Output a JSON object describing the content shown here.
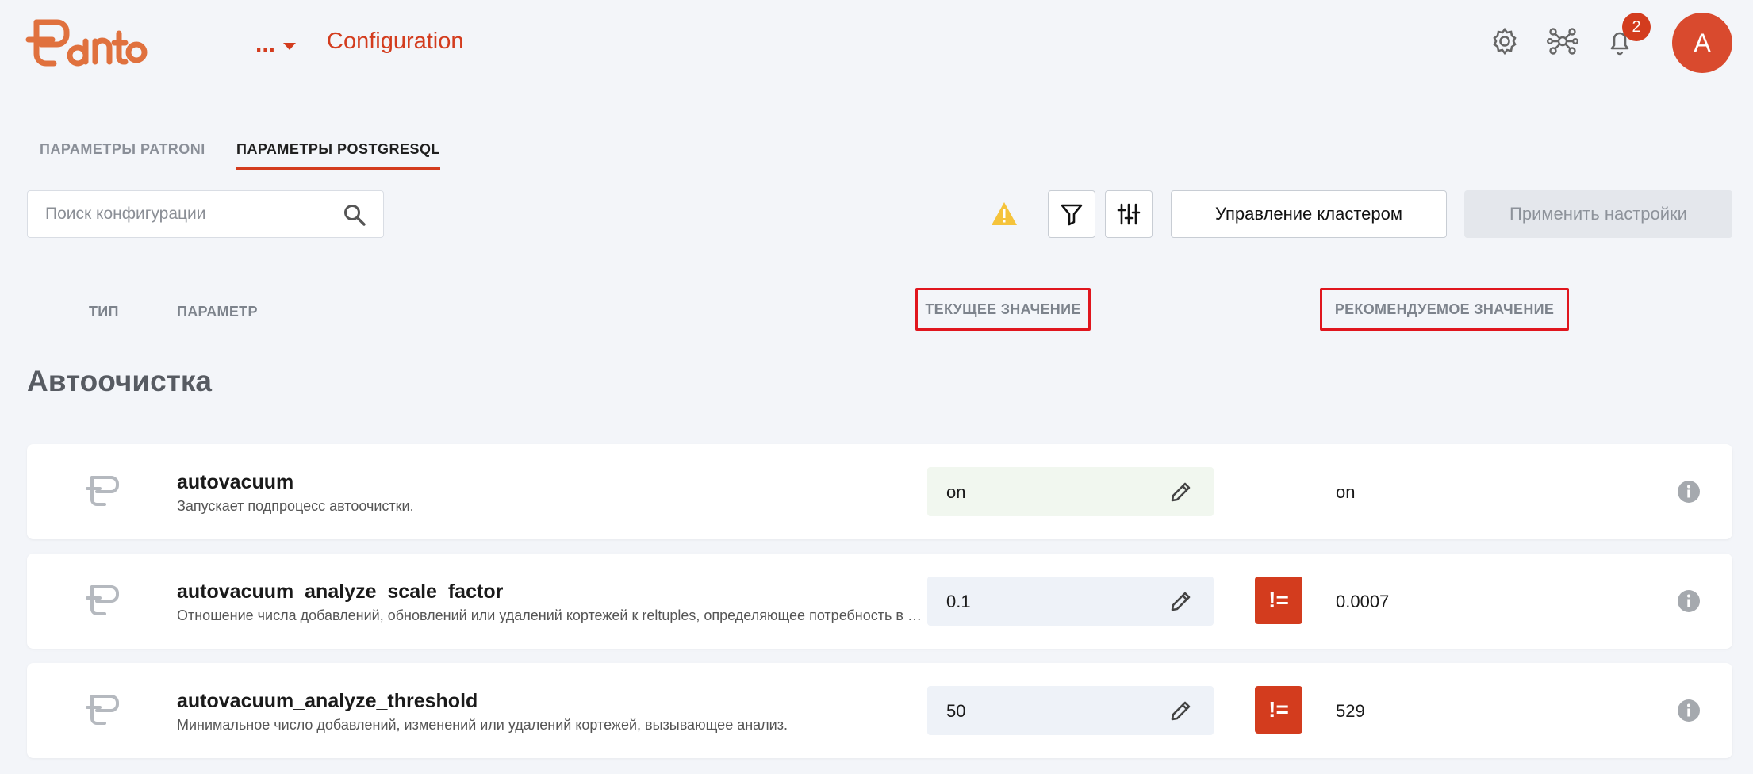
{
  "header": {
    "cluster_name": "...",
    "page_title": "Configuration",
    "notification_count": "2",
    "avatar_letter": "A"
  },
  "tabs": [
    {
      "label": "ПАРАМЕТРЫ PATRONI",
      "active": false
    },
    {
      "label": "ПАРАМЕТРЫ POSTGRESQL",
      "active": true
    }
  ],
  "toolbar": {
    "search_placeholder": "Поиск конфигурации",
    "manage_cluster_label": "Управление кластером",
    "apply_settings_label": "Применить настройки"
  },
  "columns": {
    "type": "ТИП",
    "parameter": "ПАРАМЕТР",
    "current": "ТЕКУЩЕЕ ЗНАЧЕНИЕ",
    "recommended": "РЕКОМЕНДУЕМОЕ ЗНАЧЕНИЕ"
  },
  "section_title": "Автоочистка",
  "rows": [
    {
      "name": "autovacuum",
      "description": "Запускает подпроцесс автоочистки.",
      "current": "on",
      "recommended": "on",
      "mismatch": false
    },
    {
      "name": "autovacuum_analyze_scale_factor",
      "description": "Отношение числа добавлений, обновлений или удалений кортежей к reltuples, определяющее потребность в анализе.",
      "current": "0.1",
      "recommended": "0.0007",
      "mismatch": true,
      "mismatch_label": "!="
    },
    {
      "name": "autovacuum_analyze_threshold",
      "description": "Минимальное число добавлений, изменений или удалений кортежей, вызывающее анализ.",
      "current": "50",
      "recommended": "529",
      "mismatch": true,
      "mismatch_label": "!="
    }
  ],
  "colors": {
    "brand": "#d33c1e",
    "highlight_border": "#e0161e",
    "warning": "#f5c33b"
  }
}
